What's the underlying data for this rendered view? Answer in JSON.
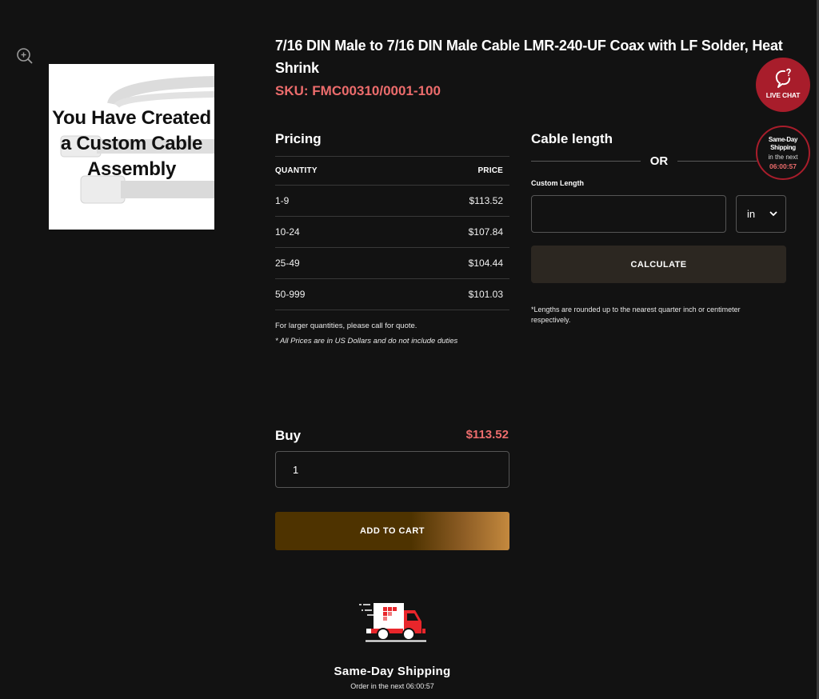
{
  "gallery": {
    "zoom_icon": "zoom-in-icon",
    "image_caption": "You Have Created a Custom Cable Assembly"
  },
  "product": {
    "title": "7/16 DIN Male to 7/16 DIN Male Cable LMR-240-UF Coax with LF Solder, Heat Shrink",
    "sku": "SKU: FMC00310/0001-100"
  },
  "pricing": {
    "heading": "Pricing",
    "columns": [
      "QUANTITY",
      "PRICE"
    ],
    "rows": [
      {
        "quantity": "1-9",
        "price": "$113.52"
      },
      {
        "quantity": "10-24",
        "price": "$107.84"
      },
      {
        "quantity": "25-49",
        "price": "$104.44"
      },
      {
        "quantity": "50-999",
        "price": "$101.03"
      }
    ],
    "note_quote": "For larger quantities, please call for quote.",
    "note_currency": "* All Prices are in US Dollars and do not include duties"
  },
  "cable_length": {
    "heading": "Cable length",
    "or_label": "OR",
    "custom_label": "Custom Length",
    "custom_value": "",
    "unit_selected": "in",
    "calculate_label": "CALCULATE",
    "note": "*Lengths are rounded up to the nearest quarter inch or centimeter respectively."
  },
  "buy": {
    "label": "Buy",
    "price": "$113.52",
    "quantity": "1",
    "add_to_cart_label": "ADD TO CART"
  },
  "shipping": {
    "icon": "delivery-truck-icon",
    "title": "Same-Day Shipping",
    "subtitle": "Order in the next 06:00:57"
  },
  "floating": {
    "live_chat_label": "LIVE CHAT",
    "badge_line1": "Same-Day Shipping",
    "badge_line2": "in the next",
    "badge_timer": "06:00:57"
  },
  "colors": {
    "background": "#121212",
    "accent_red": "#a81d2b",
    "price_pink": "#ec6c6c",
    "cart_gradient_start": "#4e3300",
    "cart_gradient_end": "#c4893e"
  }
}
